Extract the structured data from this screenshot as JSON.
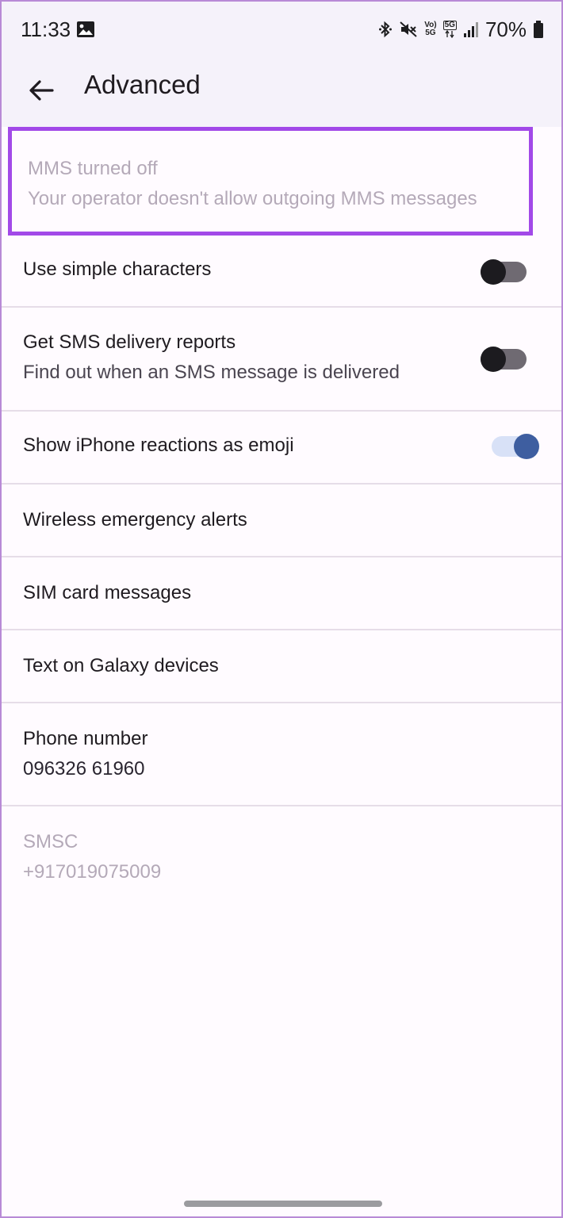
{
  "status_bar": {
    "time": "11:33",
    "volte": "Vo)",
    "volte_sub": "5G",
    "network": "5G",
    "battery": "70%"
  },
  "app_bar": {
    "title": "Advanced"
  },
  "mms": {
    "title": "MMS turned off",
    "subtitle": "Your operator doesn't allow outgoing MMS messages"
  },
  "settings": {
    "simple_chars": {
      "label": "Use simple characters",
      "enabled": false
    },
    "delivery_reports": {
      "label": "Get SMS delivery reports",
      "subtitle": "Find out when an SMS message is delivered",
      "enabled": false
    },
    "iphone_reactions": {
      "label": "Show iPhone reactions as emoji",
      "enabled": true
    },
    "emergency_alerts": {
      "label": "Wireless emergency alerts"
    },
    "sim_messages": {
      "label": "SIM card messages"
    },
    "galaxy": {
      "label": "Text on Galaxy devices"
    },
    "phone_number": {
      "label": "Phone number",
      "value": "096326 61960"
    },
    "smsc": {
      "label": "SMSC",
      "value": "+917019075009"
    }
  },
  "icons": [
    "gallery-icon",
    "bluetooth-icon",
    "mute-icon",
    "signal-icon",
    "battery-icon",
    "back-arrow-icon"
  ],
  "colors": {
    "highlight": "#a249e8",
    "toggle_on": "#3e5ea0",
    "toggle_off": "#1c1b1f"
  }
}
